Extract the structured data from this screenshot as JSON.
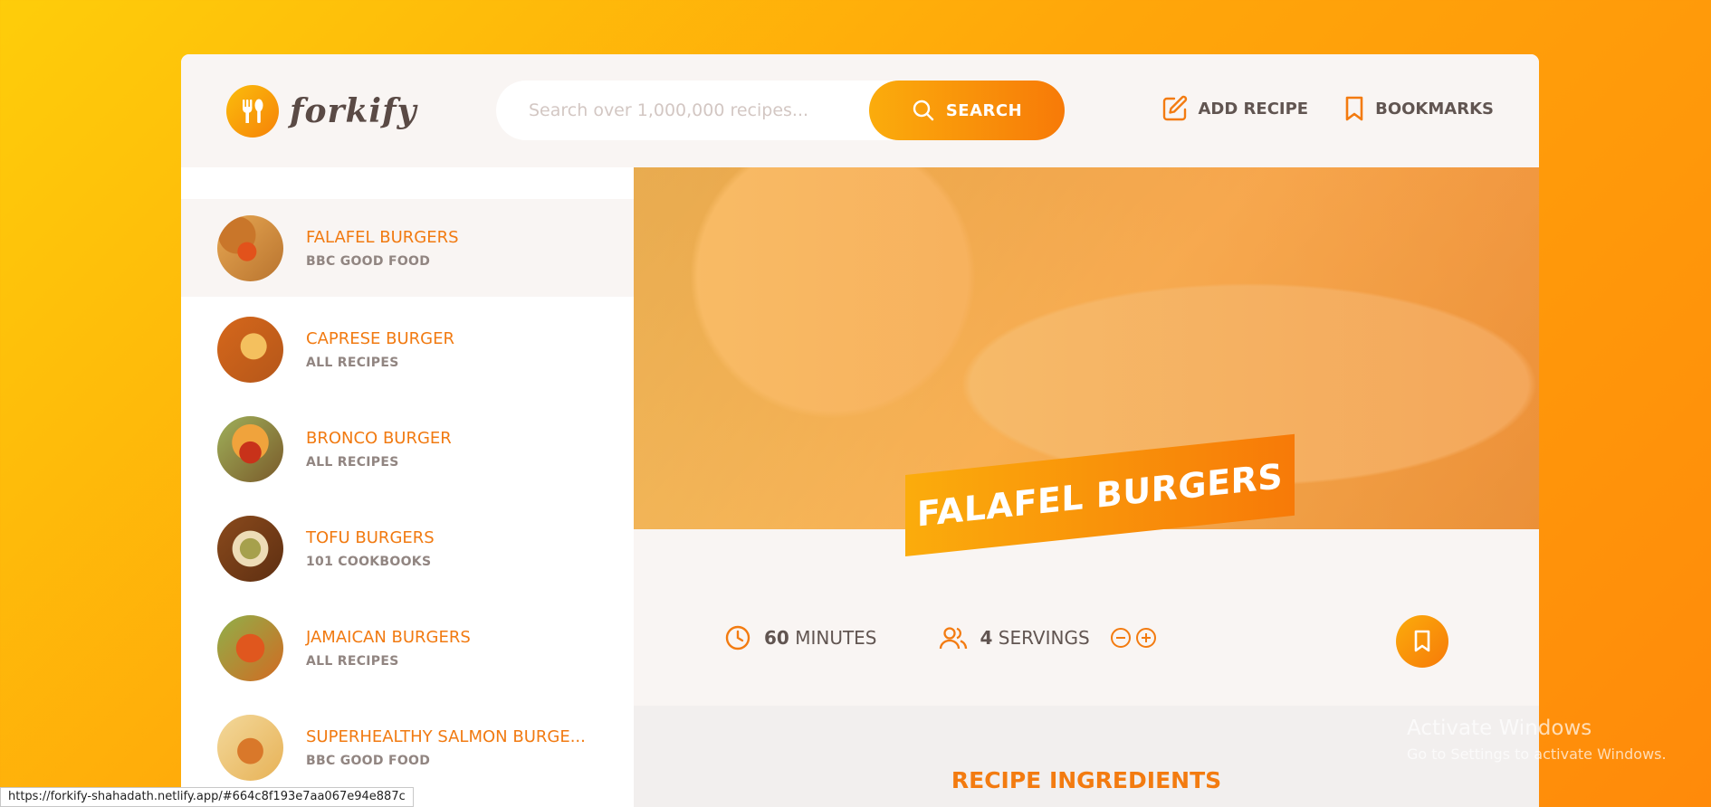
{
  "header": {
    "logo_text": "forkify",
    "search_placeholder": "Search over 1,000,000 recipes...",
    "search_label": "SEARCH",
    "nav": {
      "add_recipe": "ADD RECIPE",
      "bookmarks": "BOOKMARKS"
    }
  },
  "results": [
    {
      "title": "FALAFEL BURGERS",
      "publisher": "BBC GOOD FOOD",
      "active": true
    },
    {
      "title": "CAPRESE BURGER",
      "publisher": "ALL RECIPES",
      "active": false
    },
    {
      "title": "BRONCO BURGER",
      "publisher": "ALL RECIPES",
      "active": false
    },
    {
      "title": "TOFU BURGERS",
      "publisher": "101 COOKBOOKS",
      "active": false
    },
    {
      "title": "JAMAICAN BURGERS",
      "publisher": "ALL RECIPES",
      "active": false
    },
    {
      "title": "SUPERHEALTHY SALMON BURGE...",
      "publisher": "BBC GOOD FOOD",
      "active": false
    }
  ],
  "recipe": {
    "title": "FALAFEL BURGERS",
    "minutes": "60",
    "minutes_label": "MINUTES",
    "servings": "4",
    "servings_label": "SERVINGS",
    "ingredients_heading": "RECIPE INGREDIENTS"
  },
  "status_bar": {
    "url": "https://forkify-shahadath.netlify.app/#664c8f193e7aa067e94e887c"
  },
  "watermark": {
    "line1": "Activate Windows",
    "line2": "Go to Settings to activate Windows."
  },
  "colors": {
    "accent_start": "#fbac0c",
    "accent_end": "#f77a08",
    "title_color": "#f37b10",
    "bg_light": "#f9f5f3"
  }
}
